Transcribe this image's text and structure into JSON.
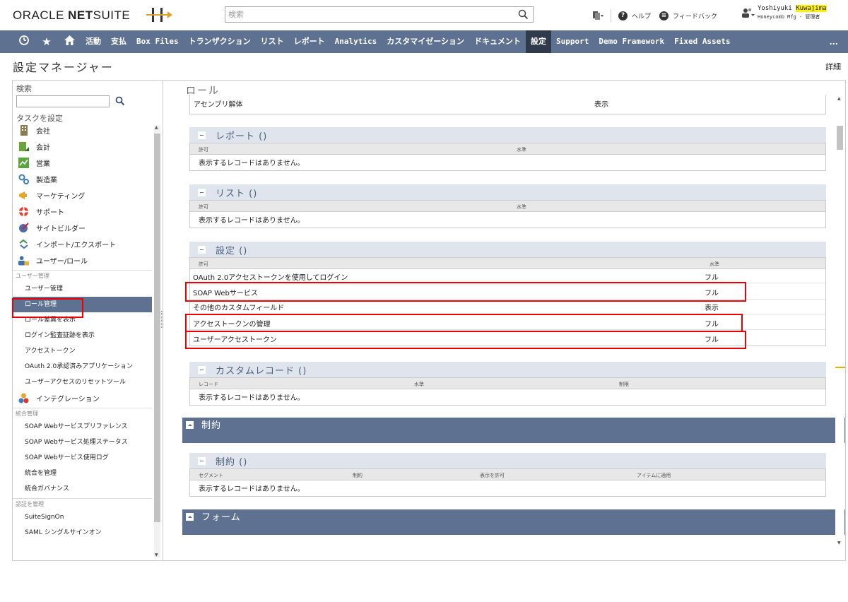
{
  "header": {
    "logo_main": "ORACLE ",
    "logo_bold": "NET",
    "logo_tail": "SUITE",
    "search_placeholder": "検索",
    "help": "ヘルプ",
    "feedback": "フィードバック",
    "user_first": "Yoshiyuki ",
    "user_last": "Kuwajima",
    "user_sub": "Honeycomb Mfg - 管理者"
  },
  "nav": {
    "items": [
      "活動",
      "支払",
      "Box Files",
      "トランザクション",
      "リスト",
      "レポート",
      "Analytics",
      "カスタマイゼーション",
      "ドキュメント",
      "設定",
      "Support",
      "Demo Framework",
      "Fixed Assets"
    ],
    "more": "..."
  },
  "page": {
    "title": "設定マネージャー",
    "detail": "詳細"
  },
  "left": {
    "search_label": "検索",
    "task_label": "タスクを設定",
    "categories": [
      "会社",
      "会計",
      "営業",
      "製造業",
      "マーケティング",
      "サポート",
      "サイトビルダー",
      "インポート/エクスポート",
      "ユーザー/ロール"
    ],
    "user_mgmt_section": "ユーザー管理",
    "user_mgmt_links": [
      "ユーザー管理",
      "ロール管理",
      "ロール差異を表示",
      "ログイン監査証跡を表示",
      "アクセストークン",
      "OAuth 2.0承認済みアプリケーション",
      "ユーザーアクセスのリセットツール"
    ],
    "integration_category": "インテグレーション",
    "integration_section": "統合管理",
    "integration_links": [
      "SOAP Webサービスプリファレンス",
      "SOAP Webサービス処理ステータス",
      "SOAP Webサービス使用ログ",
      "統合を管理",
      "統合ガバナンス"
    ],
    "auth_section": "認証を管理",
    "auth_links": [
      "SuiteSignOn",
      "SAML シングルサインオン"
    ]
  },
  "right": {
    "title": "ロール",
    "top_row": {
      "name": "アセンブリ解体",
      "level": "表示"
    },
    "reports": {
      "title": "レポート ()",
      "col_perm": "許可",
      "col_level": "水準",
      "empty": "表示するレコードはありません。"
    },
    "lists": {
      "title": "リスト ()",
      "col_perm": "許可",
      "col_level": "水準",
      "empty": "表示するレコードはありません。"
    },
    "setup": {
      "title": "設定 ()",
      "col_perm": "許可",
      "col_level": "水準",
      "rows": [
        {
          "name": "OAuth 2.0アクセストークンを使用してログイン",
          "level": "フル"
        },
        {
          "name": "SOAP Webサービス",
          "level": "フル"
        },
        {
          "name": "その他のカスタムフィールド",
          "level": "表示"
        },
        {
          "name": "アクセストークンの管理",
          "level": "フル"
        },
        {
          "name": "ユーザーアクセストークン",
          "level": "フル"
        }
      ]
    },
    "custom_records": {
      "title": "カスタムレコード ()",
      "col_record": "レコード",
      "col_level": "水準",
      "col_restrict": "制限",
      "empty": "表示するレコードはありません。"
    },
    "restrictions_bar": "制約",
    "restrictions": {
      "title": "制約 ()",
      "col_segment": "セグメント",
      "col_restrict": "制約",
      "col_allow": "表示を許可",
      "col_apply": "アイテムに適用",
      "empty": "表示するレコードはありません。"
    },
    "forms_bar": "フォーム"
  }
}
